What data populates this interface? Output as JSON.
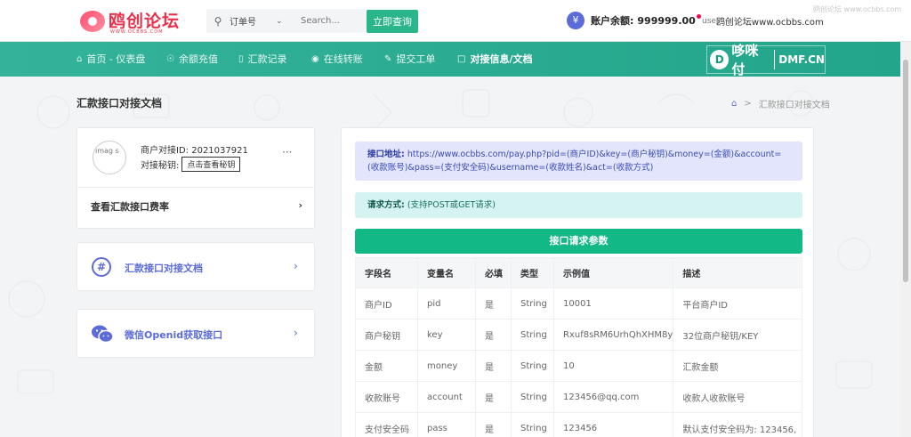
{
  "header": {
    "logo_text": "鸥创论坛",
    "logo_sub": "WWW.OCBBS.COM",
    "search_type": "订单号",
    "search_placeholder": "Search...",
    "search_button": "立即查询",
    "balance_label": "账户余额:",
    "balance_value": "999999.00",
    "avatar_alt": "use",
    "user_name": "鸥创论坛www.ocbbs.com",
    "watermark": "鸥创论坛 www.ocbbs.com"
  },
  "nav": {
    "items": [
      {
        "icon": "home-icon",
        "label": "首页 - 仪表盘"
      },
      {
        "icon": "recharge-icon",
        "label": "余额充值"
      },
      {
        "icon": "chart-icon",
        "label": "汇款记录"
      },
      {
        "icon": "transfer-icon",
        "label": "在线转账"
      },
      {
        "icon": "edit-icon",
        "label": "提交工单"
      },
      {
        "icon": "doc-icon",
        "label": "对接信息/文档"
      }
    ],
    "brand_text": "哆咪付",
    "brand_en": "DMF.CN"
  },
  "page": {
    "title": "汇款接口对接文档",
    "breadcrumb": "汇款接口对接文档"
  },
  "merchant": {
    "avatar_alt": "imag s",
    "id_label": "商户对接ID:",
    "id_value": "2021037921",
    "secret_label": "对接秘钥:",
    "secret_button": "点击查看秘钥",
    "more": "···",
    "fee_label": "查看汇款接口费率"
  },
  "links": {
    "doc_label": "汇款接口对接文档",
    "openid_label": "微信Openid获取接口"
  },
  "doc": {
    "addr_label": "接口地址:",
    "addr_value": "https://www.ocbbs.com/pay.php?pid=(商户ID)&key=(商户秘钥)&money=(金额)&account=(收款账号)&pass=(支付安全码)&username=(收款姓名)&act=(收款方式)",
    "method_label": "请求方式:",
    "method_value": "(支持POST或GET请求)",
    "param_header": "接口请求参数",
    "columns": [
      "字段名",
      "变量名",
      "必填",
      "类型",
      "示例值",
      "描述"
    ],
    "rows": [
      [
        "商户ID",
        "pid",
        "是",
        "String",
        "10001",
        "平台商户ID"
      ],
      [
        "商户秘钥",
        "key",
        "是",
        "String",
        "Rxuf8sRM6UrhQhXHM8y",
        "32位商户秘钥/KEY"
      ],
      [
        "金额",
        "money",
        "是",
        "String",
        "10",
        "汇款金额"
      ],
      [
        "收款账号",
        "account",
        "是",
        "String",
        "123456@qq.com",
        "收款人收款账号"
      ],
      [
        "支付安全码",
        "pass",
        "是",
        "String",
        "123456",
        "默认支付安全码为: 123456,"
      ]
    ]
  },
  "colors": {
    "accent_green": "#12b886",
    "nav_teal": "#2aab91",
    "indigo": "#5b6bd8"
  }
}
